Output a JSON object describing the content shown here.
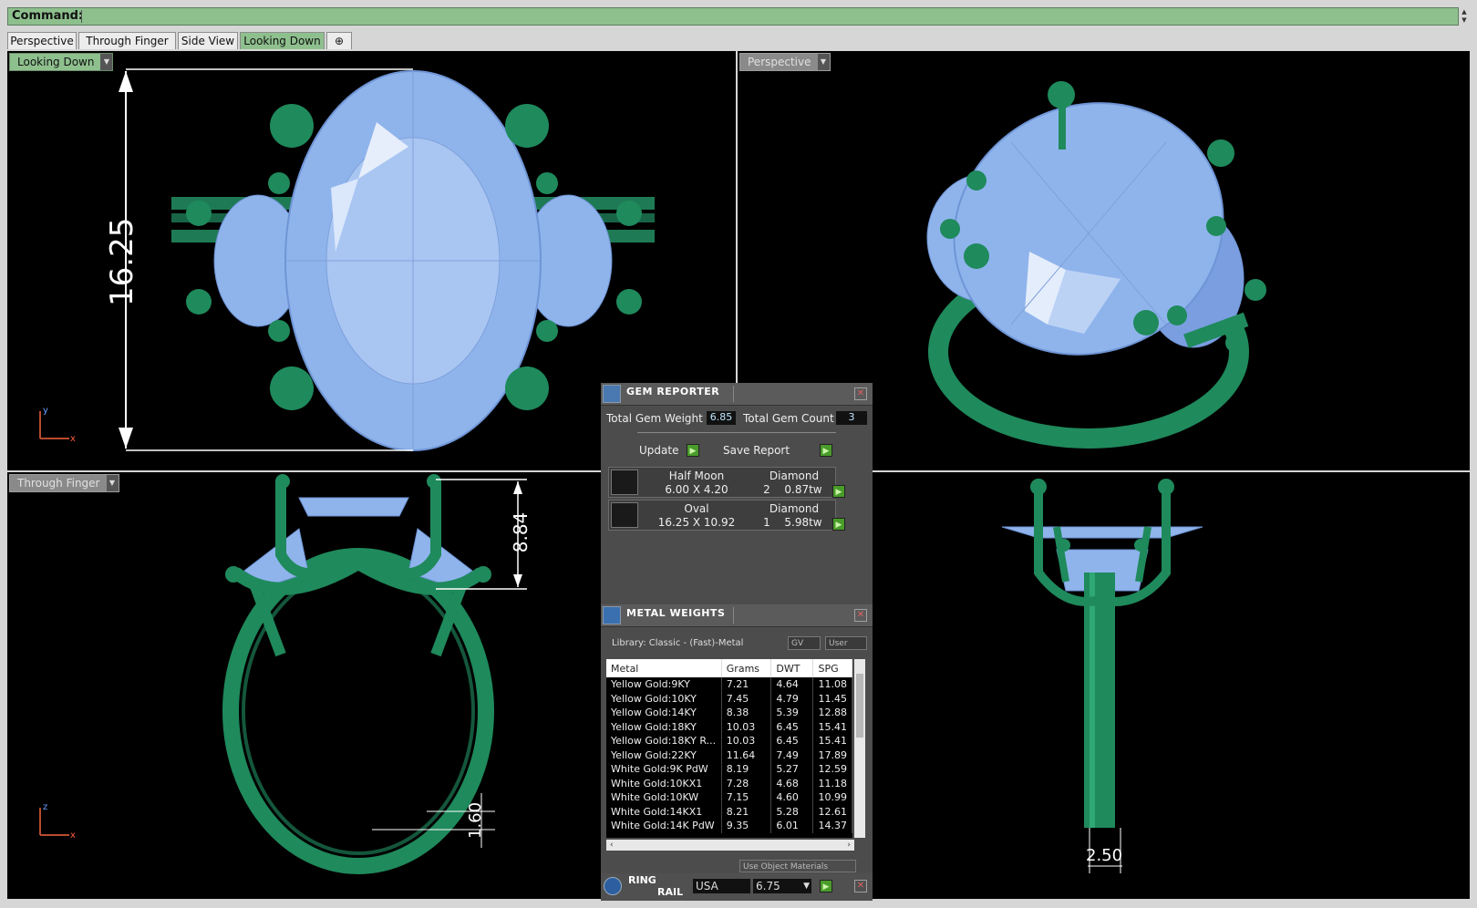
{
  "command": {
    "label": "Command:"
  },
  "tabs": [
    "Perspective",
    "Through Finger",
    "Side View",
    "Looking Down",
    "⊕"
  ],
  "viewports": {
    "top_left": {
      "label": "Looking Down",
      "dimension": "16.25"
    },
    "top_right": {
      "label": "Perspective"
    },
    "bottom_left": {
      "label": "Through Finger",
      "dimension_height": "8.84",
      "dimension_shank": "1.60"
    },
    "bottom_right": {
      "dimension_width": "2.50"
    }
  },
  "gem_reporter": {
    "title": "GEM REPORTER",
    "total_weight_label": "Total Gem Weight",
    "total_weight": "6.85",
    "total_count_label": "Total Gem Count",
    "total_count": "3",
    "update_label": "Update",
    "save_label": "Save Report",
    "gems": [
      {
        "shape": "Half Moon",
        "material": "Diamond",
        "size": "6.00 X 4.20",
        "count": "2",
        "weight": "0.87tw"
      },
      {
        "shape": "Oval",
        "material": "Diamond",
        "size": "16.25 X 10.92",
        "count": "1",
        "weight": "5.98tw"
      }
    ]
  },
  "metal_weights": {
    "title": "METAL WEIGHTS",
    "library": "Library: Classic - (Fast)-Metal",
    "toggle_gv": "GV",
    "toggle_user": "User",
    "columns": [
      "Metal",
      "Grams",
      "DWT",
      "SPG"
    ],
    "rows": [
      [
        "Yellow Gold:9KY",
        "7.21",
        "4.64",
        "11.08"
      ],
      [
        "Yellow Gold:10KY",
        "7.45",
        "4.79",
        "11.45"
      ],
      [
        "Yellow Gold:14KY",
        "8.38",
        "5.39",
        "12.88"
      ],
      [
        "Yellow Gold:18KY",
        "10.03",
        "6.45",
        "15.41"
      ],
      [
        "Yellow Gold:18KY R...",
        "10.03",
        "6.45",
        "15.41"
      ],
      [
        "Yellow Gold:22KY",
        "11.64",
        "7.49",
        "17.89"
      ],
      [
        "White Gold:9K PdW",
        "8.19",
        "5.27",
        "12.59"
      ],
      [
        "White Gold:10KX1",
        "7.28",
        "4.68",
        "11.18"
      ],
      [
        "White Gold:10KW",
        "7.15",
        "4.60",
        "10.99"
      ],
      [
        "White Gold:14KX1",
        "8.21",
        "5.28",
        "12.61"
      ],
      [
        "White Gold:14K PdW",
        "9.35",
        "6.01",
        "14.37"
      ]
    ],
    "use_object_materials": "Use Object Materials"
  },
  "ring_rail": {
    "title_line1": "RING",
    "title_line2": "RAIL",
    "standard": "USA",
    "size": "6.75"
  },
  "colors": {
    "command_bg": "#8ec08e",
    "metal": "#1f8a5c",
    "gem": "#8fb4ec",
    "panel_bg": "#4c4c4c"
  }
}
